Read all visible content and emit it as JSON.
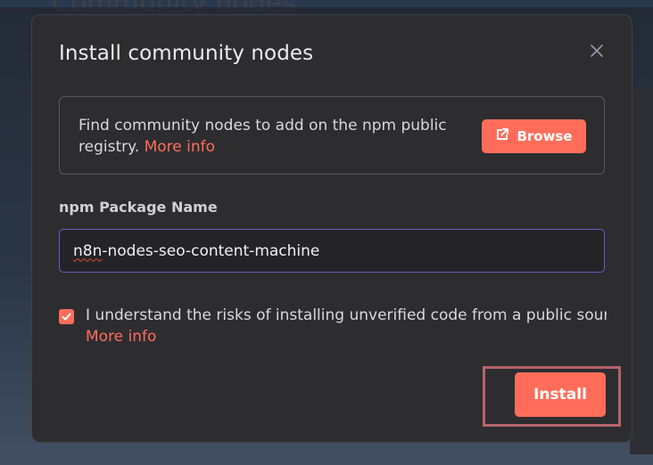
{
  "backdrop": {
    "title": "Community nodes"
  },
  "modal": {
    "title": "Install community nodes",
    "close_icon": "close-icon",
    "info": {
      "text": "Find community nodes to add on the npm public registry.",
      "more_info_link": "More info",
      "browse_label": "Browse",
      "browse_icon": "external-link-icon"
    },
    "package_field": {
      "label": "npm Package Name",
      "value_prefix_misspelled": "n8n",
      "value_rest": "-nodes-seo-content-machine"
    },
    "consent": {
      "checked": true,
      "text": "I understand the risks of installing unverified code from a public source.",
      "more_info_link": "More info"
    },
    "install_label": "Install"
  },
  "colors": {
    "accent": "#ff6d5a",
    "modal_bg": "#2d2d30",
    "input_focus_border": "#6b5cc4",
    "highlight_outline": "#b5646b"
  }
}
